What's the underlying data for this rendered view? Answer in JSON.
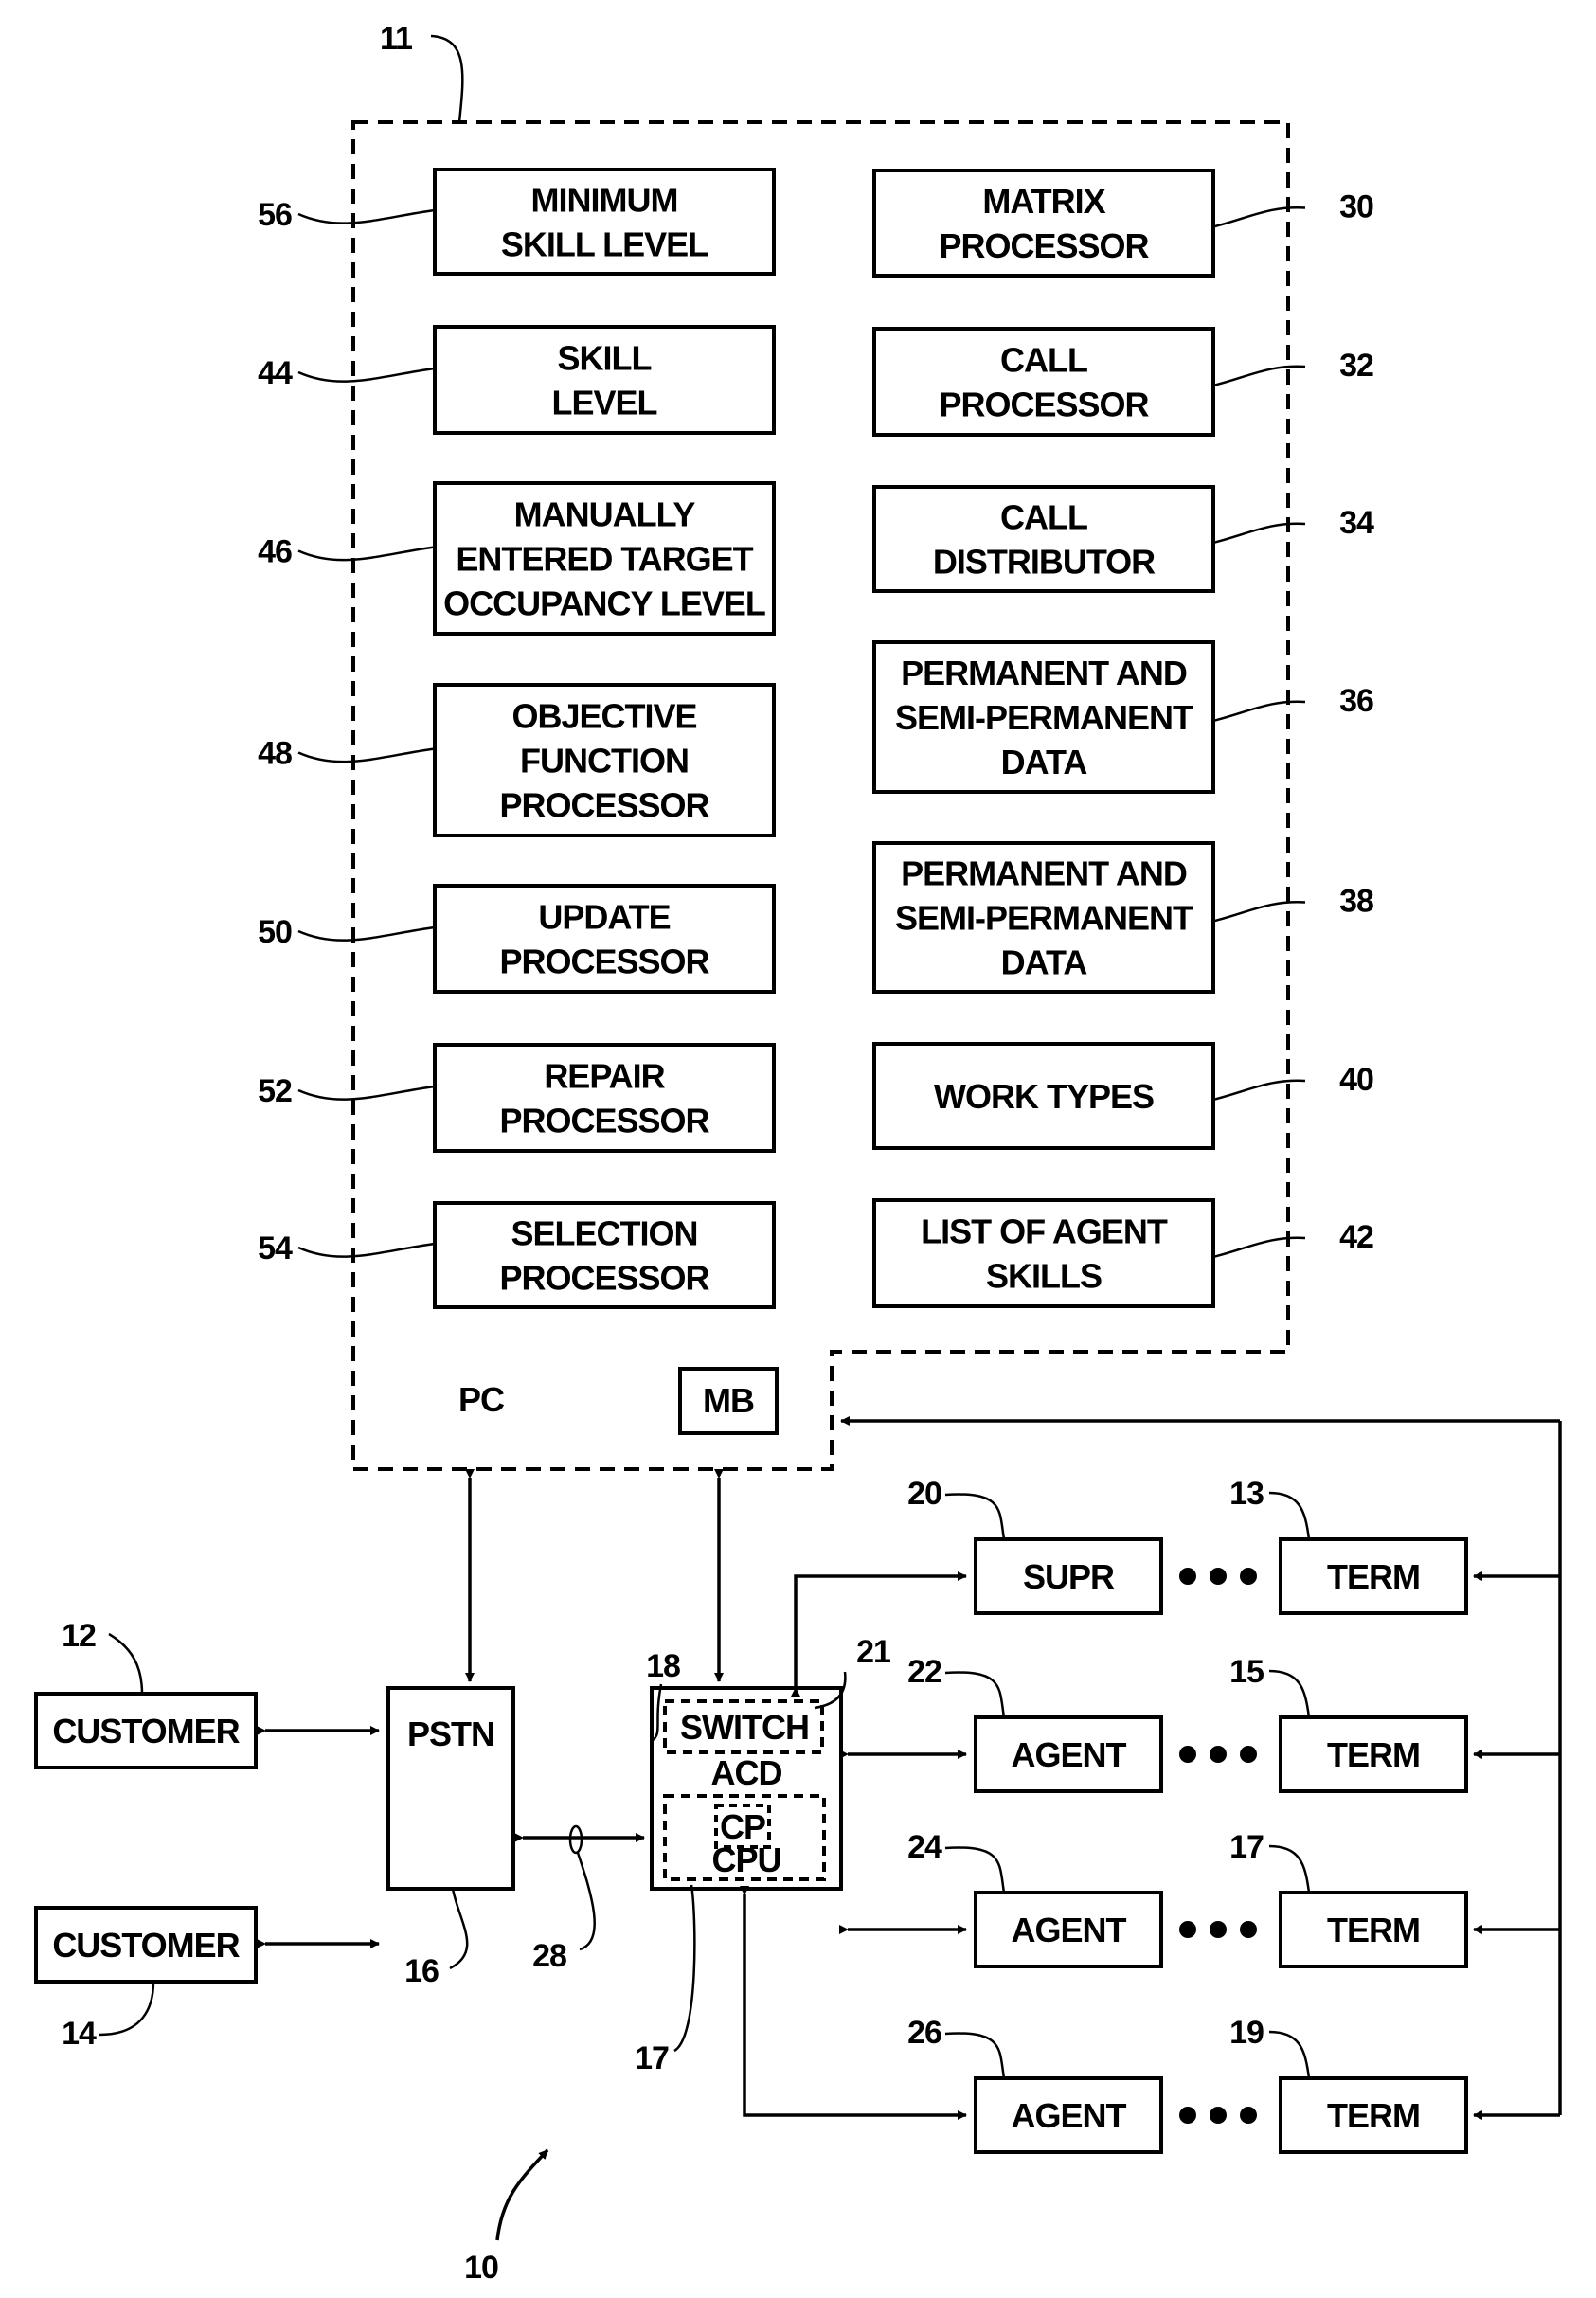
{
  "figure": {
    "system_ref": "10",
    "pc": {
      "ref": "11",
      "label": "PC",
      "mb_label": "MB"
    },
    "left_column": [
      {
        "ref": "56",
        "lines": [
          "MINIMUM",
          "SKILL LEVEL"
        ]
      },
      {
        "ref": "44",
        "lines": [
          "SKILL",
          "LEVEL"
        ]
      },
      {
        "ref": "46",
        "lines": [
          "MANUALLY",
          "ENTERED TARGET",
          "OCCUPANCY LEVEL"
        ]
      },
      {
        "ref": "48",
        "lines": [
          "OBJECTIVE",
          "FUNCTION",
          "PROCESSOR"
        ]
      },
      {
        "ref": "50",
        "lines": [
          "UPDATE",
          "PROCESSOR"
        ]
      },
      {
        "ref": "52",
        "lines": [
          "REPAIR",
          "PROCESSOR"
        ]
      },
      {
        "ref": "54",
        "lines": [
          "SELECTION",
          "PROCESSOR"
        ]
      }
    ],
    "right_column": [
      {
        "ref": "30",
        "lines": [
          "MATRIX",
          "PROCESSOR"
        ]
      },
      {
        "ref": "32",
        "lines": [
          "CALL",
          "PROCESSOR"
        ]
      },
      {
        "ref": "34",
        "lines": [
          "CALL",
          "DISTRIBUTOR"
        ]
      },
      {
        "ref": "36",
        "lines": [
          "PERMANENT AND",
          "SEMI-PERMANENT",
          "DATA"
        ]
      },
      {
        "ref": "38",
        "lines": [
          "PERMANENT AND",
          "SEMI-PERMANENT",
          "DATA"
        ]
      },
      {
        "ref": "40",
        "lines": [
          "WORK TYPES"
        ]
      },
      {
        "ref": "42",
        "lines": [
          "LIST OF AGENT",
          "SKILLS"
        ]
      }
    ],
    "customers": [
      {
        "ref": "12",
        "label": "CUSTOMER"
      },
      {
        "ref": "14",
        "label": "CUSTOMER"
      }
    ],
    "pstn": {
      "ref": "16",
      "label": "PSTN"
    },
    "trunk_ref": "28",
    "acd": {
      "ref": "18",
      "label": "ACD",
      "switch_ref": "21",
      "switch_label": "SWITCH",
      "cpu_ref": "17",
      "cpu_label": "CPU",
      "cp_label": "CP"
    },
    "stations": [
      {
        "ref": "20",
        "label": "SUPR",
        "term_ref": "13",
        "term_label": "TERM"
      },
      {
        "ref": "22",
        "label": "AGENT",
        "term_ref": "15",
        "term_label": "TERM"
      },
      {
        "ref": "24",
        "label": "AGENT",
        "term_ref": "17",
        "term_label": "TERM"
      },
      {
        "ref": "26",
        "label": "AGENT",
        "term_ref": "19",
        "term_label": "TERM"
      }
    ]
  }
}
